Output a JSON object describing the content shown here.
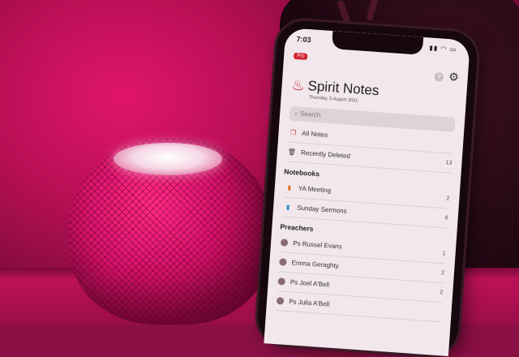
{
  "status": {
    "time": "7:03",
    "icons": "▮▮ ◠ ▭"
  },
  "header": {
    "badge": "Pro",
    "title": "Spirit Notes",
    "date": "Thursday, 5 August 2021"
  },
  "search": {
    "placeholder": "Search"
  },
  "library": [
    {
      "label": "All Notes",
      "count": "",
      "icon": "notes-icon"
    },
    {
      "label": "Recently Deleted",
      "count": "13",
      "icon": "trash-icon"
    }
  ],
  "notebooks": {
    "heading": "Notebooks",
    "items": [
      {
        "label": "YA Meeting",
        "count": "2",
        "icon": "notebook-icon"
      },
      {
        "label": "Sunday Sermons",
        "count": "6",
        "icon": "notebook-icon"
      }
    ]
  },
  "preachers": {
    "heading": "Preachers",
    "items": [
      {
        "label": "Ps Russel Evans",
        "count": "1"
      },
      {
        "label": "Emma Geraghty",
        "count": "2"
      },
      {
        "label": "Ps Joel A'Bell",
        "count": "2"
      },
      {
        "label": "Ps Julia A'Bell",
        "count": ""
      }
    ]
  },
  "colors": {
    "accent": "#d3232f",
    "background": "#c3125c"
  }
}
